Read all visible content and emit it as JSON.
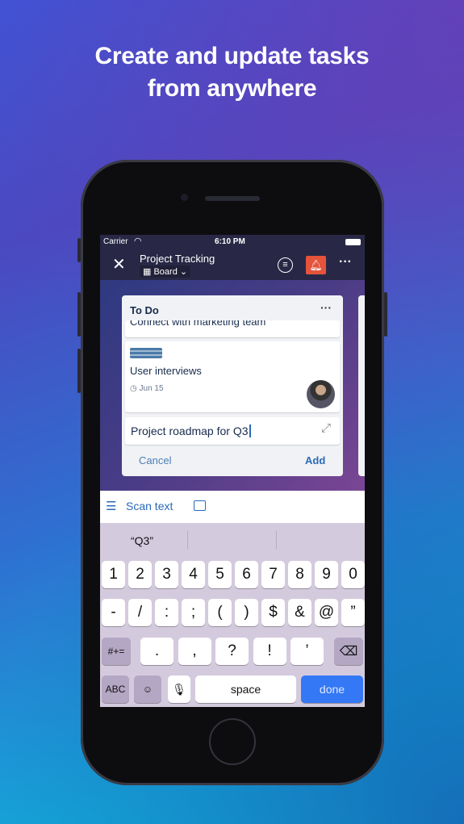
{
  "headline": {
    "line1": "Create and update tasks",
    "line2": "from anywhere"
  },
  "status_bar": {
    "carrier": "Carrier",
    "time": "6:10 PM"
  },
  "nav": {
    "title": "Project Tracking",
    "view": "Board",
    "notification_color": "#e5533b"
  },
  "list": {
    "title": "To Do",
    "cards": [
      {
        "title": "Connect with marketing team"
      },
      {
        "title": "User interviews",
        "due": "Jun 15"
      }
    ],
    "new_card_value": "Project roadmap for Q3",
    "cancel": "Cancel",
    "add": "Add"
  },
  "suggestion_bar": {
    "scan_text": "Scan text"
  },
  "keyboard": {
    "prediction": "“Q3”",
    "row1": [
      "1",
      "2",
      "3",
      "4",
      "5",
      "6",
      "7",
      "8",
      "9",
      "0"
    ],
    "row2": [
      "-",
      "/",
      ":",
      ";",
      "(",
      ")",
      "$",
      "&",
      "@",
      "”"
    ],
    "row3": [
      "#+=",
      ".",
      ",",
      "?",
      "!",
      "’"
    ],
    "abc": "ABC",
    "space": "space",
    "done": "done"
  }
}
